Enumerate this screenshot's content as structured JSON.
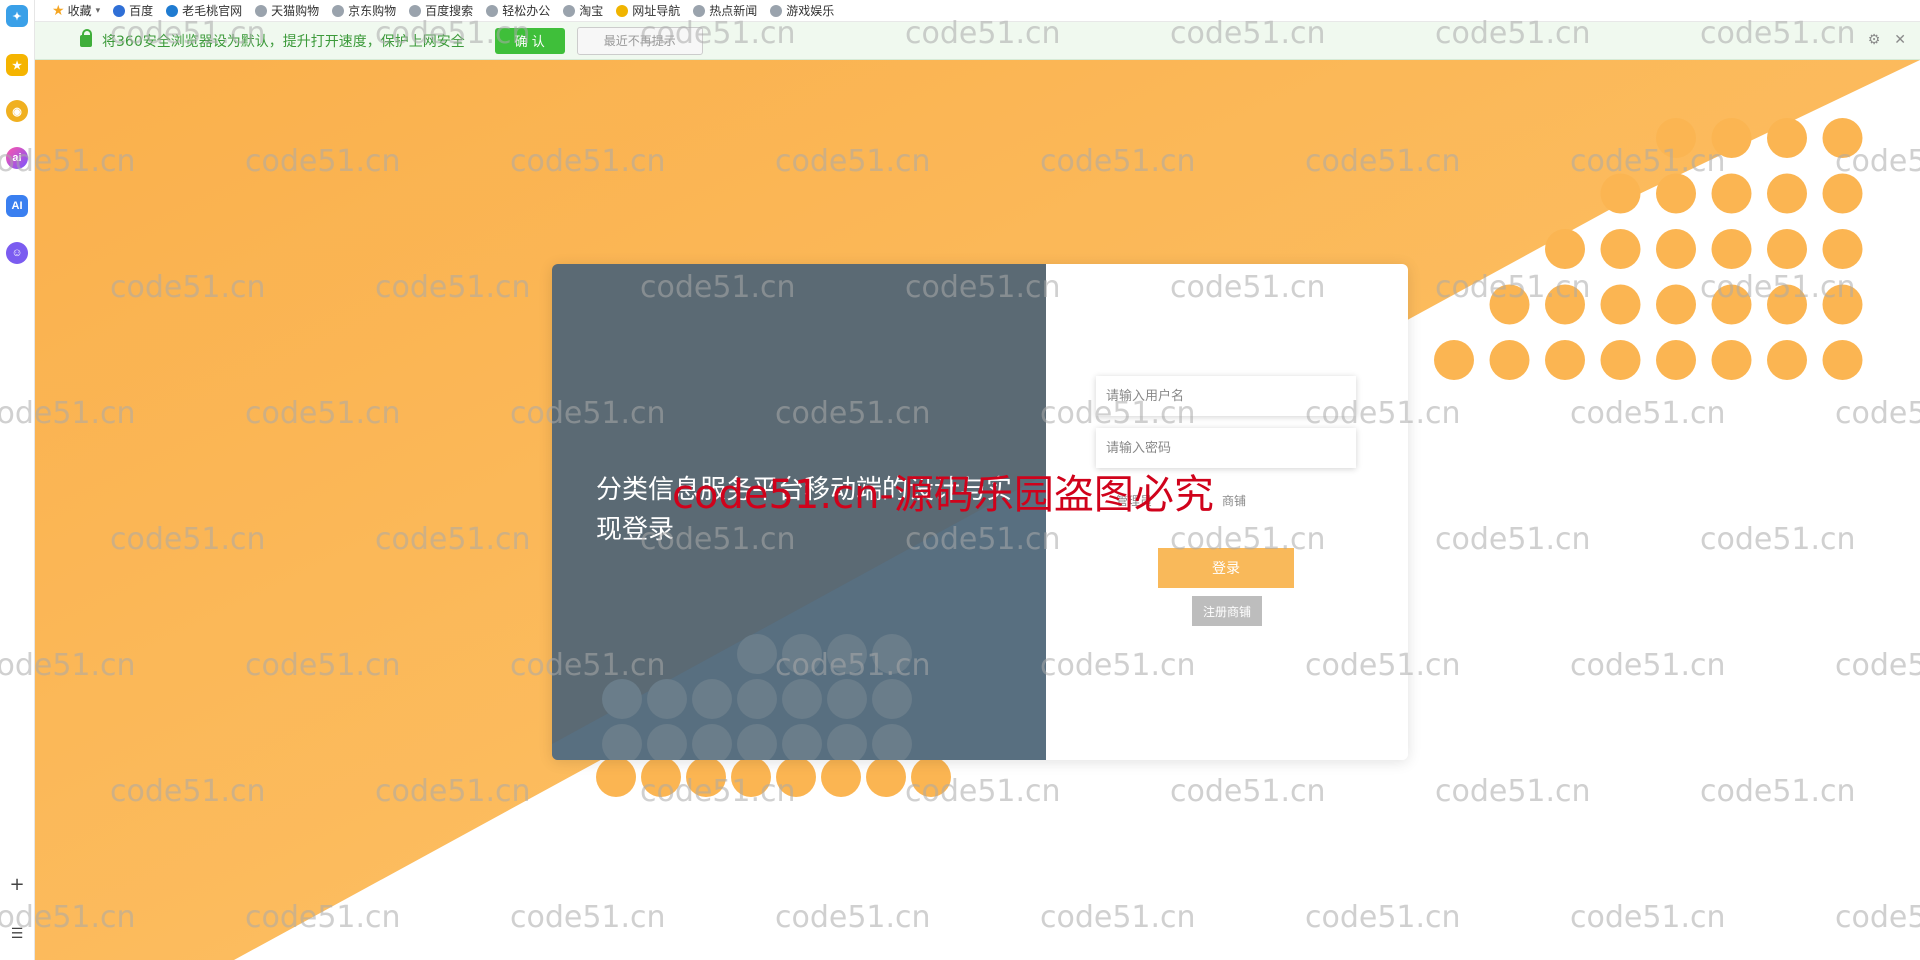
{
  "sidebar": {
    "icons": [
      "new-tab-icon",
      "favorites-star-icon",
      "assistant-robot-icon",
      "ai-gradient-icon",
      "ai-badge-icon",
      "chat-ghost-icon"
    ],
    "add_label": "+",
    "menu_label": "☰"
  },
  "bookmarks": {
    "items": [
      {
        "label": "收藏",
        "icon": "star-icon"
      },
      {
        "label": "百度",
        "icon": "paw-icon"
      },
      {
        "label": "老毛桃官网",
        "icon": "globe-icon"
      },
      {
        "label": "天猫购物",
        "icon": "globe-icon"
      },
      {
        "label": "京东购物",
        "icon": "globe-icon"
      },
      {
        "label": "百度搜索",
        "icon": "globe-icon"
      },
      {
        "label": "轻松办公",
        "icon": "globe-icon"
      },
      {
        "label": "淘宝",
        "icon": "globe-icon"
      },
      {
        "label": "网址导航",
        "icon": "compass-icon"
      },
      {
        "label": "热点新闻",
        "icon": "globe-icon"
      },
      {
        "label": "游戏娱乐",
        "icon": "globe-icon"
      }
    ]
  },
  "notice": {
    "text": "将360安全浏览器设为默认，提升打开速度，保护上网安全",
    "confirm_label": "确 认",
    "later_label": "最近不再提示"
  },
  "login": {
    "title": "分类信息服务平台移动端的设计与实现登录",
    "username_placeholder": "请输入用户名",
    "password_placeholder": "请输入密码",
    "roles": [
      "管理员",
      "商铺"
    ],
    "login_label": "登录",
    "register_label": "注册商铺"
  },
  "watermark": {
    "text": "code51.cn",
    "red_text": "code51.cn-源码乐园盗图必究"
  },
  "colors": {
    "accent_orange": "#f9b95a",
    "panel_slate": "#5b6a74",
    "notice_green": "#3fbf3a"
  }
}
